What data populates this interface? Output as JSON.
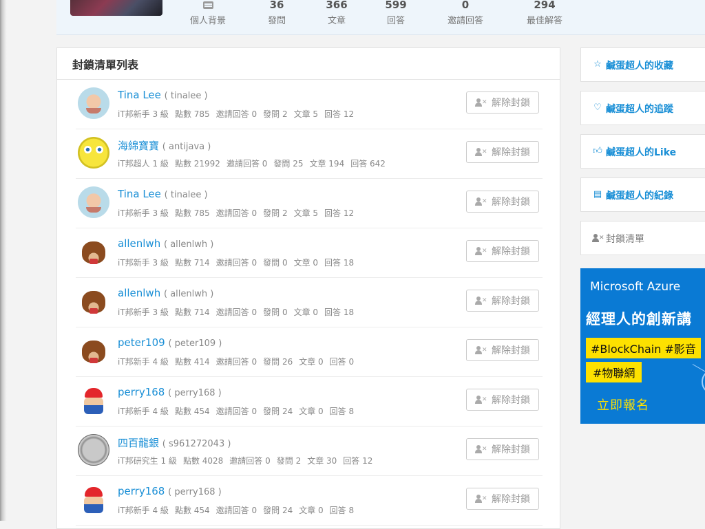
{
  "profile": {
    "stats": [
      {
        "num": "",
        "label": "個人背景",
        "icon": "profile-card-icon"
      },
      {
        "num": "36",
        "label": "發問"
      },
      {
        "num": "366",
        "label": "文章"
      },
      {
        "num": "599",
        "label": "回答"
      },
      {
        "num": "0",
        "label": "邀請回答"
      },
      {
        "num": "294",
        "label": "最佳解答"
      }
    ]
  },
  "block_list": {
    "title": "封鎖清單列表",
    "unblock_label": "解除封鎖",
    "rows": [
      {
        "name": "Tina Lee",
        "id": "( tinalee )",
        "level": "iT邦新手 3 級",
        "points": "點數 785",
        "invites": "邀請回答 0",
        "asks": "發問 2",
        "articles": "文章 5",
        "answers": "回答 12",
        "avatar": "baby"
      },
      {
        "name": "海綿寶寶",
        "id": "( antijava )",
        "level": "iT邦超人 1 級",
        "points": "點數 21992",
        "invites": "邀請回答 0",
        "asks": "發問 25",
        "articles": "文章 194",
        "answers": "回答 642",
        "avatar": "sponge"
      },
      {
        "name": "Tina Lee",
        "id": "( tinalee )",
        "level": "iT邦新手 3 級",
        "points": "點數 785",
        "invites": "邀請回答 0",
        "asks": "發問 2",
        "articles": "文章 5",
        "answers": "回答 12",
        "avatar": "baby"
      },
      {
        "name": "allenlwh",
        "id": "( allenlwh )",
        "level": "iT邦新手 3 級",
        "points": "點數 714",
        "invites": "邀請回答 0",
        "asks": "發問 0",
        "articles": "文章 0",
        "answers": "回答 18",
        "avatar": "bear"
      },
      {
        "name": "allenlwh",
        "id": "( allenlwh )",
        "level": "iT邦新手 3 級",
        "points": "點數 714",
        "invites": "邀請回答 0",
        "asks": "發問 0",
        "articles": "文章 0",
        "answers": "回答 18",
        "avatar": "bear"
      },
      {
        "name": "peter109",
        "id": "( peter109 )",
        "level": "iT邦新手 4 級",
        "points": "點數 414",
        "invites": "邀請回答 0",
        "asks": "發問 26",
        "articles": "文章 0",
        "answers": "回答 0",
        "avatar": "bear"
      },
      {
        "name": "perry168",
        "id": "( perry168 )",
        "level": "iT邦新手 4 級",
        "points": "點數 454",
        "invites": "邀請回答 0",
        "asks": "發問 24",
        "articles": "文章 0",
        "answers": "回答 8",
        "avatar": "mario"
      },
      {
        "name": "四百龍銀",
        "id": "( s961272043 )",
        "level": "iT邦研究生 1 級",
        "points": "點數 4028",
        "invites": "邀請回答 0",
        "asks": "發問 2",
        "articles": "文章 30",
        "answers": "回答 12",
        "avatar": "coin"
      },
      {
        "name": "perry168",
        "id": "( perry168 )",
        "level": "iT邦新手 4 級",
        "points": "點數 454",
        "invites": "邀請回答 0",
        "asks": "發問 24",
        "articles": "文章 0",
        "answers": "回答 8",
        "avatar": "mario"
      }
    ]
  },
  "sidebar": {
    "items": [
      {
        "label": "鹹蛋超人的收藏",
        "icon": "star-icon"
      },
      {
        "label": "鹹蛋超人的追蹤",
        "icon": "heart-icon"
      },
      {
        "label": "鹹蛋超人的Like",
        "icon": "thumbs-up-icon"
      },
      {
        "label": "鹹蛋超人的紀錄",
        "icon": "document-icon"
      },
      {
        "label": "封鎖清單",
        "icon": "user-block-icon"
      }
    ]
  },
  "ad": {
    "brand": "Microsoft Azure",
    "headline": "經理人的創新講",
    "tag1": "#BlockChain #影音",
    "tag2": "#物聯網",
    "cta": "立即報名",
    "colors": {
      "background": "#0a7ad4",
      "highlight": "#fde100"
    }
  },
  "colors": {
    "link": "#1a8fd6",
    "header_bg": "#eef5fb"
  }
}
